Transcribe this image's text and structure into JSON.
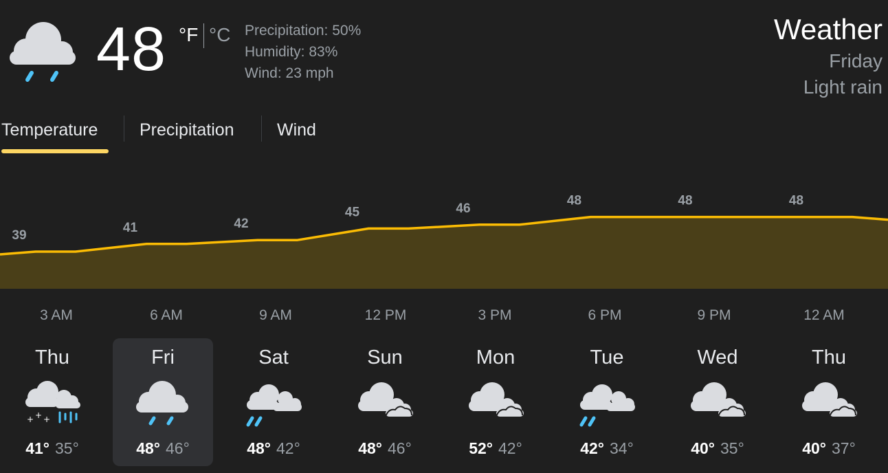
{
  "current": {
    "temperature": "48",
    "unit_f": "°F",
    "unit_c": "°C",
    "precipitation": "Precipitation: 50%",
    "humidity": "Humidity: 83%",
    "wind": "Wind: 23 mph",
    "icon": "rain-cloud-icon"
  },
  "header": {
    "title": "Weather",
    "day": "Friday",
    "condition": "Light rain"
  },
  "tabs": [
    {
      "label": "Temperature",
      "active": true
    },
    {
      "label": "Precipitation",
      "active": false
    },
    {
      "label": "Wind",
      "active": false
    }
  ],
  "colors": {
    "accent": "#fdd663",
    "line": "#fbbc04",
    "area": "#4a3f18",
    "background": "#1f1f1f",
    "selected": "#303134",
    "rain": "#4fc3f7"
  },
  "chart_data": {
    "type": "area",
    "x": [
      "3 AM",
      "6 AM",
      "9 AM",
      "12 PM",
      "3 PM",
      "6 PM",
      "9 PM",
      "12 AM"
    ],
    "values": [
      39,
      41,
      42,
      45,
      46,
      48,
      48,
      48
    ],
    "label_values": [
      "39",
      "41",
      "42",
      "45",
      "46",
      "48",
      "48",
      "48"
    ],
    "xlabel": "",
    "ylabel": ""
  },
  "hours": [
    "3 AM",
    "6 AM",
    "9 AM",
    "12 PM",
    "3 PM",
    "6 PM",
    "9 PM",
    "12 AM"
  ],
  "forecast": [
    {
      "day": "Thu",
      "high": "41°",
      "low": "35°",
      "icon": "rain-snow-icon",
      "selected": false
    },
    {
      "day": "Fri",
      "high": "48°",
      "low": "46°",
      "icon": "rain-cloud-icon",
      "selected": true
    },
    {
      "day": "Sat",
      "high": "48°",
      "low": "42°",
      "icon": "showers-icon",
      "selected": false
    },
    {
      "day": "Sun",
      "high": "48°",
      "low": "46°",
      "icon": "cloudy-icon",
      "selected": false
    },
    {
      "day": "Mon",
      "high": "52°",
      "low": "42°",
      "icon": "cloudy-icon",
      "selected": false
    },
    {
      "day": "Tue",
      "high": "42°",
      "low": "34°",
      "icon": "showers-icon",
      "selected": false
    },
    {
      "day": "Wed",
      "high": "40°",
      "low": "35°",
      "icon": "cloudy-icon",
      "selected": false
    },
    {
      "day": "Thu",
      "high": "40°",
      "low": "37°",
      "icon": "cloudy-icon",
      "selected": false
    }
  ]
}
